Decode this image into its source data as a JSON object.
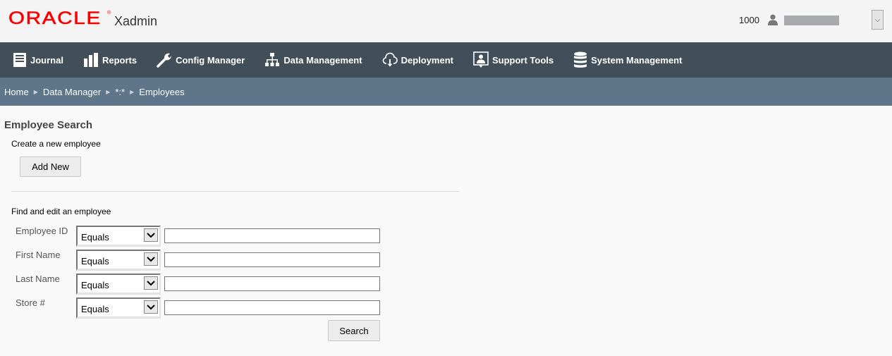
{
  "header": {
    "brand": "ORACLE",
    "brand_mark": "®",
    "app_name": "Xadmin",
    "store_number": "1000",
    "user_icon": "user-icon",
    "user_menu_icon": "chevron-down-icon",
    "user_menu_glyph": "⌵"
  },
  "nav": {
    "items": [
      {
        "label": "Journal",
        "icon": "journal-icon"
      },
      {
        "label": "Reports",
        "icon": "bar-chart-icon"
      },
      {
        "label": "Config Manager",
        "icon": "wrench-icon"
      },
      {
        "label": "Data Management",
        "icon": "hierarchy-icon"
      },
      {
        "label": "Deployment",
        "icon": "cloud-download-icon"
      },
      {
        "label": "Support Tools",
        "icon": "support-icon"
      },
      {
        "label": "System Management",
        "icon": "database-icon"
      }
    ]
  },
  "breadcrumb": {
    "items": [
      "Home",
      "Data Manager",
      "*:*",
      "Employees"
    ],
    "separator": "▶"
  },
  "main": {
    "title": "Employee Search",
    "create_label": "Create a new employee",
    "add_button": "Add New",
    "find_label": "Find and edit an employee",
    "criteria": [
      {
        "label": "Employee ID",
        "operator": "Equals",
        "value": ""
      },
      {
        "label": "First Name",
        "operator": "Equals",
        "value": ""
      },
      {
        "label": "Last Name",
        "operator": "Equals",
        "value": ""
      },
      {
        "label": "Store #",
        "operator": "Equals",
        "value": ""
      }
    ],
    "search_button": "Search"
  },
  "colors": {
    "brand_red": "#f80000",
    "nav_bg": "#434f58",
    "breadcrumb_bg": "#5f768a",
    "page_bg": "#f9f9f9"
  }
}
